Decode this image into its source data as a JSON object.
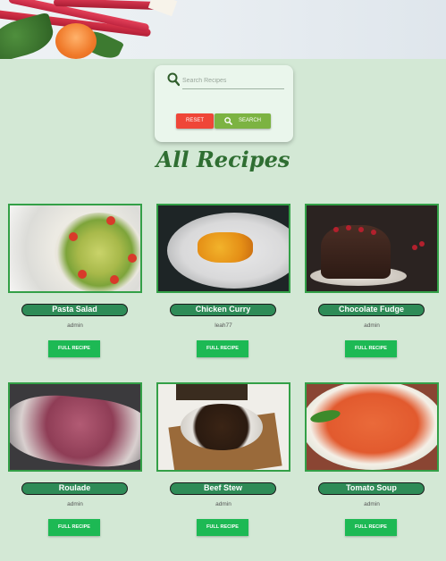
{
  "search": {
    "placeholder": "Search Recipes",
    "reset_label": "RESET",
    "search_label": "SEARCH"
  },
  "page_title": "All Recipes",
  "recipes": [
    {
      "name": "Pasta Salad",
      "author": "admin",
      "button": "FULL RECIPE"
    },
    {
      "name": "Chicken Curry",
      "author": "leah77",
      "button": "FULL RECIPE"
    },
    {
      "name": "Chocolate Fudge",
      "author": "admin",
      "button": "FULL RECIPE"
    },
    {
      "name": "Roulade",
      "author": "admin",
      "button": "FULL RECIPE"
    },
    {
      "name": "Beef Stew",
      "author": "admin",
      "button": "FULL RECIPE"
    },
    {
      "name": "Tomato Soup",
      "author": "admin",
      "button": "FULL RECIPE"
    }
  ],
  "colors": {
    "background": "#d3e8d5",
    "title": "#2f6e32",
    "reset": "#ef4638",
    "search": "#7cb342",
    "name_badge": "#2e8b57",
    "full_recipe": "#1db954"
  }
}
